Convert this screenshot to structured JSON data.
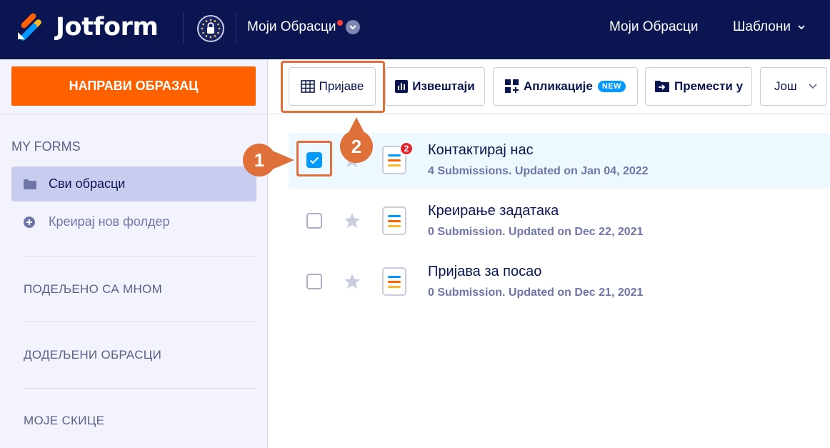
{
  "header": {
    "brand": "Jotform",
    "my_forms_dropdown": "Моји Обрасци",
    "nav_my_forms": "Моји Обрасци",
    "nav_templates": "Шаблони"
  },
  "sidebar": {
    "create_button": "НАПРАВИ ОБРАЗАЦ",
    "my_forms_heading": "MY FORMS",
    "all_forms": "Сви обрасци",
    "create_folder": "Креирај нов фолдер",
    "shared_with_me": "ПОДЕЉЕНО СА МНОМ",
    "assigned_forms": "ДОДЕЉЕНИ ОБРАСЦИ",
    "my_drafts": "МОЈЕ СКИЦЕ"
  },
  "toolbar": {
    "submissions": "Пријаве",
    "reports": "Извештаји",
    "apps": "Апликације",
    "apps_badge": "NEW",
    "move_to": "Премести у",
    "more": "Још"
  },
  "forms": [
    {
      "title": "Контактирај нас",
      "meta": "4 Submissions. Updated on Jan 04, 2022",
      "badge": "2",
      "selected": true
    },
    {
      "title": "Креирање задатака",
      "meta": "0 Submission. Updated on Dec 22, 2021",
      "badge": "",
      "selected": false
    },
    {
      "title": "Пријава за посао",
      "meta": "0 Submission. Updated on Dec 21, 2021",
      "badge": "",
      "selected": false
    }
  ],
  "annotations": {
    "step1": "1",
    "step2": "2"
  },
  "colors": {
    "navy": "#0a1551",
    "orange": "#ff6100",
    "accent_blue": "#0099ff",
    "annotation": "#e0703a"
  }
}
